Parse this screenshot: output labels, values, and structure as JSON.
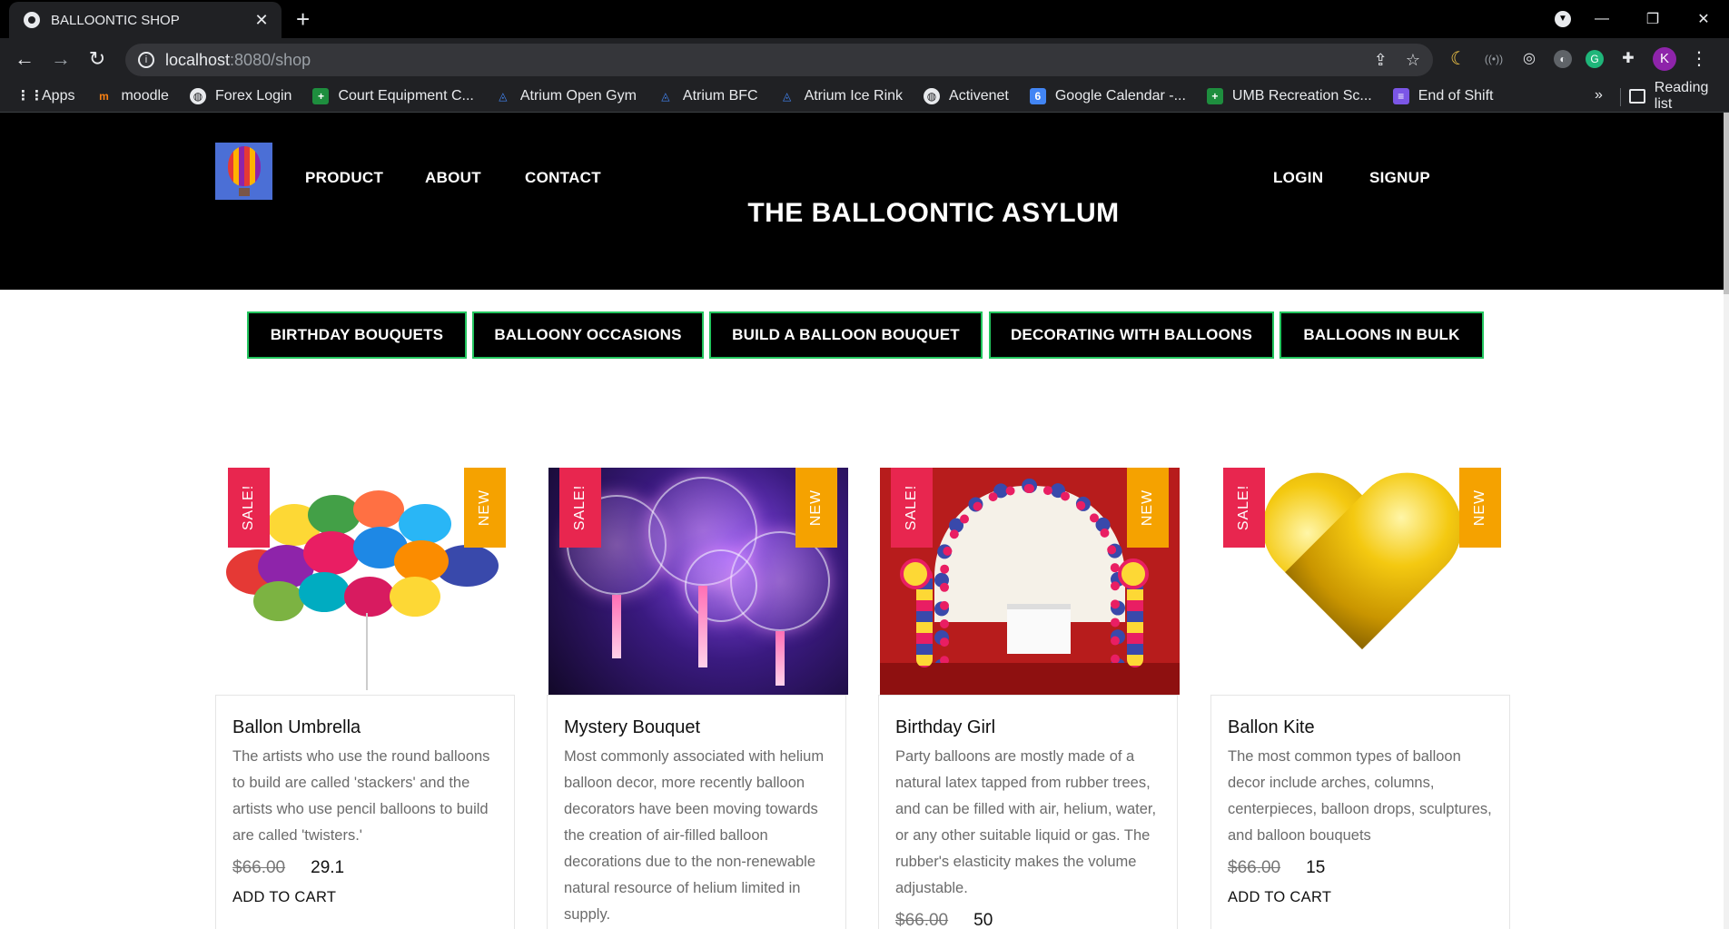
{
  "browser": {
    "tab_title": "BALLOONTIC SHOP",
    "url_host": "localhost",
    "url_path": ":8080/shop",
    "profile_initial": "K",
    "bookmarks": [
      {
        "label": "Apps",
        "icon": "apps-grid-icon"
      },
      {
        "label": "moodle",
        "icon": "moodle-icon"
      },
      {
        "label": "Forex Login",
        "icon": "globe-icon"
      },
      {
        "label": "Court Equipment C...",
        "icon": "green-plus-icon"
      },
      {
        "label": "Atrium Open Gym",
        "icon": "atrium-icon"
      },
      {
        "label": "Atrium BFC",
        "icon": "atrium-icon"
      },
      {
        "label": "Atrium Ice Rink",
        "icon": "atrium-icon"
      },
      {
        "label": "Activenet",
        "icon": "globe-icon"
      },
      {
        "label": "Google Calendar -...",
        "icon": "google-calendar-icon",
        "badge": "6"
      },
      {
        "label": "UMB Recreation Sc...",
        "icon": "green-plus-icon"
      },
      {
        "label": "End of Shift",
        "icon": "form-list-icon"
      }
    ],
    "bookmarks_more": "»",
    "reading_list": "Reading list"
  },
  "site": {
    "title": "THE BALLOONTIC ASYLUM",
    "nav": {
      "product": "PRODUCT",
      "about": "ABOUT",
      "contact": "CONTACT",
      "login": "LOGIN",
      "signup": "SIGNUP"
    },
    "categories": [
      "BIRTHDAY BOUQUETS",
      "BALLOONY OCCASIONS",
      "BUILD A BALLOON BOUQUET",
      "DECORATING WITH BALLOONS",
      "BALLOONS IN BULK"
    ],
    "colors": {
      "accent_border": "#22c55e",
      "sale_badge": "#e8264f",
      "new_badge": "#f5a200"
    }
  },
  "products": [
    {
      "badge_sale": "SALE!",
      "badge_new": "NEW",
      "name": "Ballon Umbrella",
      "description": "The artists who use the round balloons to build are called 'stackers' and the artists who use pencil balloons to build are called 'twisters.'",
      "old_price": "$66.00",
      "price": "29.1",
      "cta": "ADD TO CART"
    },
    {
      "badge_sale": "SALE!",
      "badge_new": "NEW",
      "name": "Mystery Bouquet",
      "description": "Most commonly associated with helium balloon decor, more recently balloon decorators have been moving towards the creation of air-filled balloon decorations due to the non-renewable natural resource of helium limited in supply.",
      "old_price": "",
      "price": "",
      "cta": ""
    },
    {
      "badge_sale": "SALE!",
      "badge_new": "NEW",
      "name": "Birthday Girl",
      "description": "Party balloons are mostly made of a natural latex tapped from rubber trees, and can be filled with air, helium, water, or any other suitable liquid or gas. The rubber's elasticity makes the volume adjustable.",
      "old_price": "$66.00",
      "price": "50",
      "cta": ""
    },
    {
      "badge_sale": "SALE!",
      "badge_new": "NEW",
      "name": "Ballon Kite",
      "description": "The most common types of balloon decor include arches, columns, centerpieces, balloon drops, sculptures, and balloon bouquets",
      "old_price": "$66.00",
      "price": "15",
      "cta": "ADD TO CART"
    }
  ]
}
